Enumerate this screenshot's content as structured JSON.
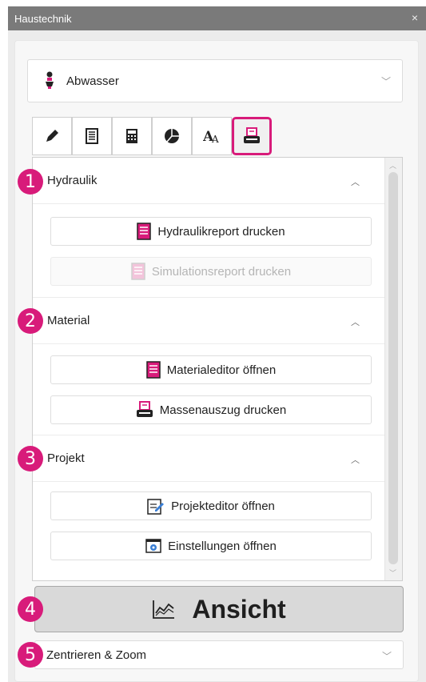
{
  "window": {
    "title": "Haustechnik",
    "close_glyph": "×"
  },
  "system_dropdown": {
    "value": "Abwasser",
    "icon": "drain-icon",
    "chevron": "﹀"
  },
  "tabs": [
    {
      "name": "edit",
      "icon": "pencil-icon"
    },
    {
      "name": "list",
      "icon": "document-list-icon"
    },
    {
      "name": "calc",
      "icon": "calculator-icon"
    },
    {
      "name": "chart",
      "icon": "pie-chart-icon"
    },
    {
      "name": "text",
      "icon": "text-style-icon"
    },
    {
      "name": "print",
      "icon": "printer-icon",
      "active": true
    }
  ],
  "sections": [
    {
      "title": "Hydraulik",
      "caret": "︿",
      "buttons": [
        {
          "label": "Hydraulikreport drucken",
          "icon": "report-icon",
          "enabled": true
        },
        {
          "label": "Simulationsreport drucken",
          "icon": "report-icon",
          "enabled": false
        }
      ]
    },
    {
      "title": "Material",
      "caret": "︿",
      "buttons": [
        {
          "label": "Materialeditor öffnen",
          "icon": "report-icon",
          "enabled": true
        },
        {
          "label": "Massenauszug drucken",
          "icon": "printer-icon",
          "enabled": true
        }
      ]
    },
    {
      "title": "Projekt",
      "caret": "︿",
      "buttons": [
        {
          "label": "Projekteditor öffnen",
          "icon": "edit-document-icon",
          "enabled": true
        },
        {
          "label": "Einstellungen öffnen",
          "icon": "settings-window-icon",
          "enabled": true
        }
      ]
    }
  ],
  "view_button": {
    "label": "Ansicht",
    "icon": "line-chart-icon"
  },
  "zoom_dropdown": {
    "label": "Zentrieren & Zoom",
    "chevron": "﹀"
  },
  "markers": [
    "1",
    "2",
    "3",
    "4",
    "5"
  ],
  "colors": {
    "accent": "#d81b7a",
    "titlebar": "#7a7a7a"
  }
}
